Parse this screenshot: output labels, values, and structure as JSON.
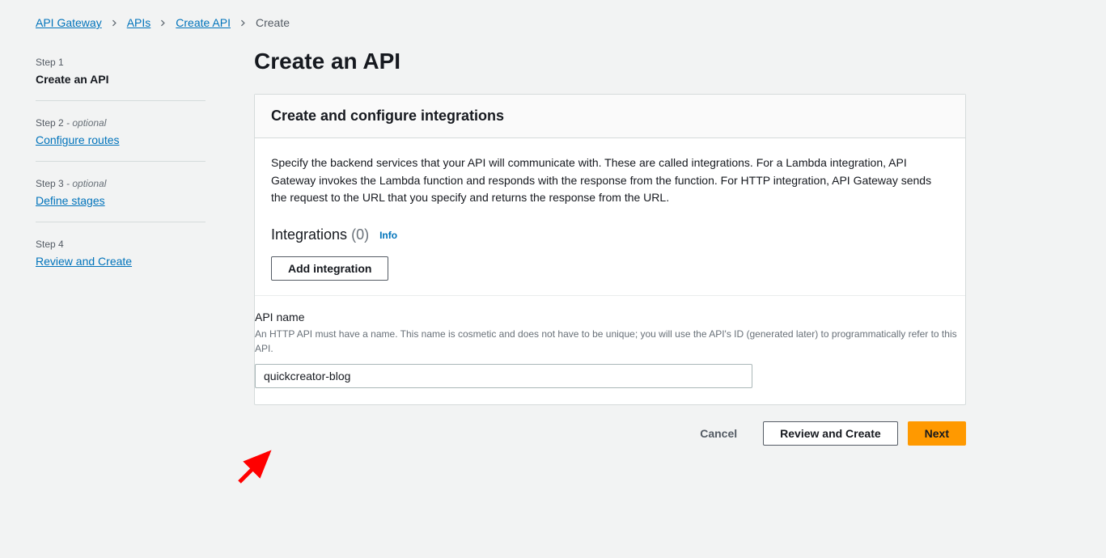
{
  "breadcrumb": {
    "items": [
      {
        "label": "API Gateway",
        "link": true
      },
      {
        "label": "APIs",
        "link": true
      },
      {
        "label": "Create API",
        "link": true
      },
      {
        "label": "Create",
        "link": false
      }
    ]
  },
  "steps": {
    "items": [
      {
        "number": "Step 1",
        "optional": "",
        "title": "Create an API",
        "current": true
      },
      {
        "number": "Step 2 ",
        "optional": "- optional",
        "title": "Configure routes",
        "current": false
      },
      {
        "number": "Step 3 ",
        "optional": "- optional",
        "title": "Define stages",
        "current": false
      },
      {
        "number": "Step 4",
        "optional": "",
        "title": "Review and Create",
        "current": false
      }
    ]
  },
  "page": {
    "title": "Create an API"
  },
  "panel": {
    "heading": "Create and configure integrations",
    "description": "Specify the backend services that your API will communicate with. These are called integrations. For a Lambda integration, API Gateway invokes the Lambda function and responds with the response from the function. For HTTP integration, API Gateway sends the request to the URL that you specify and returns the response from the URL.",
    "integrations": {
      "label": "Integrations",
      "count": "(0)",
      "info_label": "Info",
      "add_button": "Add integration"
    },
    "api_name": {
      "label": "API name",
      "hint": "An HTTP API must have a name. This name is cosmetic and does not have to be unique; you will use the API's ID (generated later) to programmatically refer to this API.",
      "value": "quickcreator-blog"
    }
  },
  "footer": {
    "cancel": "Cancel",
    "review": "Review and Create",
    "next": "Next"
  }
}
